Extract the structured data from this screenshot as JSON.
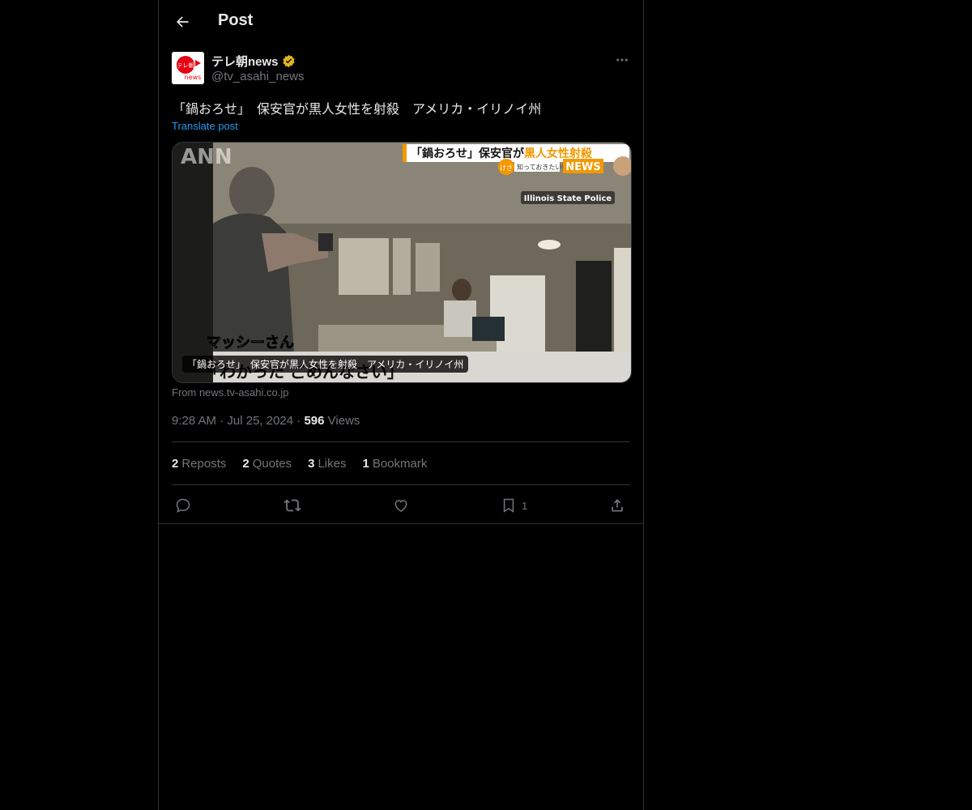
{
  "header": {
    "title": "Post"
  },
  "author": {
    "name": "テレ朝news",
    "handle": "@tv_asahi_news",
    "avatar_text_top": "テレ朝",
    "avatar_text_bottom": "news",
    "verified_color": "#e2b719"
  },
  "post": {
    "text": "「鍋おろせ」　保安官が黒人女性を射殺　アメリカ・イリノイ州",
    "translate_label": "Translate post",
    "card_caption": "「鍋おろせ」　保安官が黒人女性を射殺　アメリカ・イリノイ州",
    "card_source": "From news.tv-asahi.co.jp",
    "time": "9:28 AM",
    "date": "Jul 25, 2024",
    "views_count": "596",
    "views_label": "Views"
  },
  "video_overlay": {
    "headline_part1": "「鍋おろせ」保安官が",
    "headline_part2": "黒人女性射殺",
    "sub_label": "知っておきたい!",
    "sub_badge_left": "けさ",
    "news_badge": "NEWS",
    "credit": "Illinois State Police",
    "logo_text": "ANN",
    "subtitle_name": "マッシーさん",
    "subtitle_line": "「わかった ごめんなさい」"
  },
  "stats": {
    "reposts_count": "2",
    "reposts_label": "Reposts",
    "quotes_count": "2",
    "quotes_label": "Quotes",
    "likes_count": "3",
    "likes_label": "Likes",
    "bookmarks_count": "1",
    "bookmarks_label": "Bookmark"
  },
  "actions": {
    "bookmark_count": "1"
  },
  "colors": {
    "background": "#000000",
    "text": "#e7e9ea",
    "muted": "#71767b",
    "link": "#1d9bf0",
    "border": "#2f3336",
    "news_orange": "#f39800"
  }
}
